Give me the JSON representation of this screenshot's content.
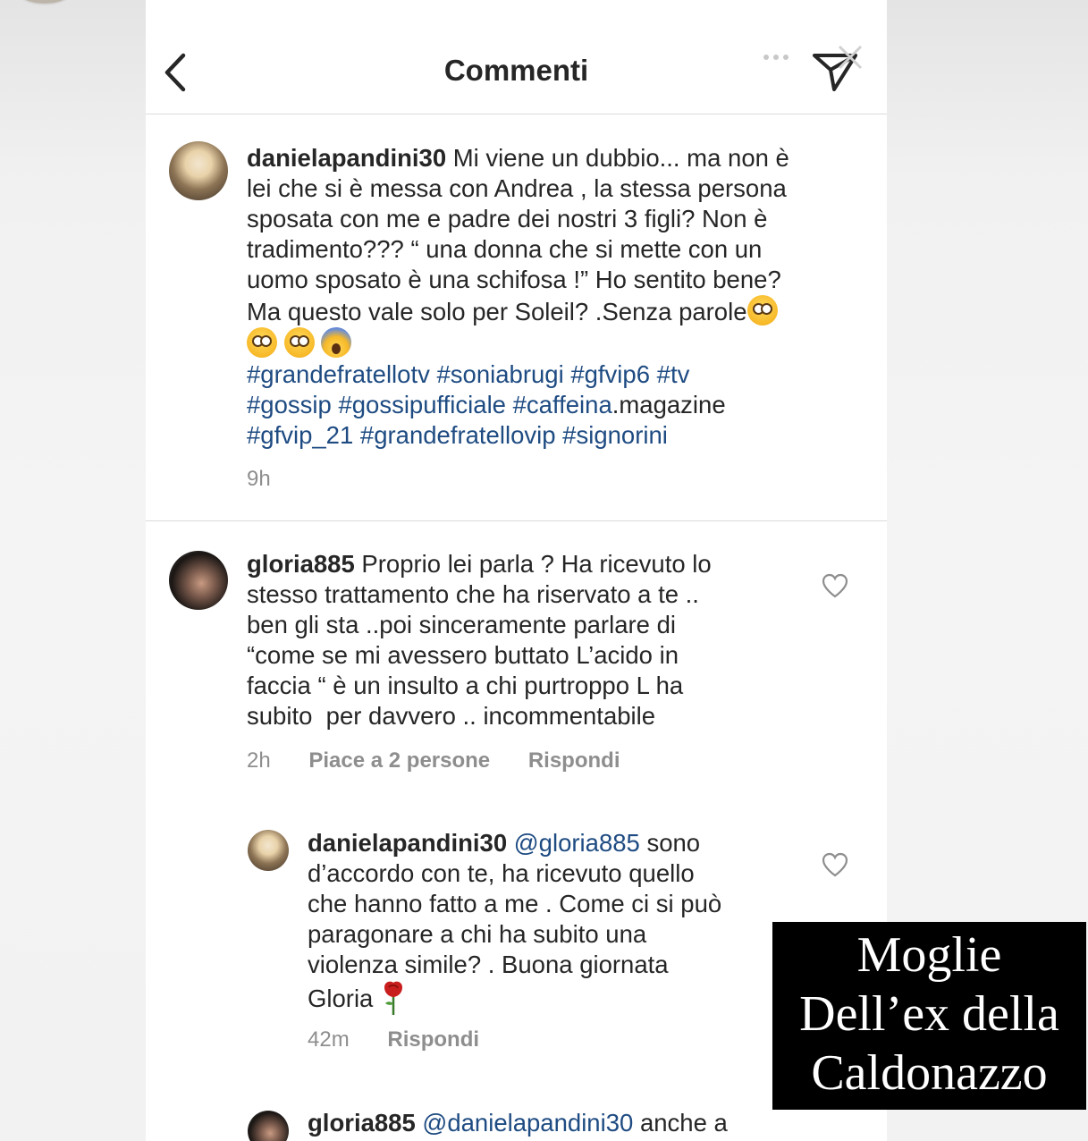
{
  "header": {
    "title": "Commenti"
  },
  "post_comment": {
    "username": "danielapandini30",
    "lines": [
      "Mi viene un dubbio... ma non è",
      "lei che si è messa con Andrea , la stessa persona",
      "sposata con me e padre dei nostri 3 figli? Non è",
      "tradimento??? “ una donna che si mette con un",
      "uomo sposato è una schifosa !” Ho sentito bene?",
      "Ma questo vale solo per Soleil? .Senza parole"
    ],
    "hashtags_line1": [
      "#grandefratellotv",
      "#soniabrugi",
      "#gfvip6",
      "#tv"
    ],
    "hashtags_line2": [
      "#gossip",
      "#gossipufficiale",
      "#caffeina"
    ],
    "hashtags_line2_suffix": ".magazine",
    "hashtags_line3": [
      "#gfvip_21",
      "#grandefratellovip",
      "#signorini"
    ],
    "time": "9h"
  },
  "comment_1": {
    "username": "gloria885",
    "lines": [
      "Proprio lei parla ? Ha ricevuto lo",
      "stesso trattamento che ha riservato a te ..",
      "ben gli sta ..poi sinceramente parlare di",
      "“come se mi avessero buttato L’acido in",
      "faccia “ è un insulto a chi purtroppo L ha",
      "subito  per davvero .. incommentabile"
    ],
    "time": "2h",
    "likes": "Piace a 2 persone",
    "reply_label": "Rispondi"
  },
  "reply_1": {
    "username": "danielapandini30",
    "mention": "@gloria885",
    "lines": [
      "sono",
      "d’accordo con te, ha ricevuto quello",
      "che hanno fatto a me . Come ci si può",
      "paragonare a chi ha subito una",
      "violenza simile? . Buona giornata",
      "Gloria"
    ],
    "time": "42m",
    "reply_label": "Rispondi"
  },
  "reply_2": {
    "username": "gloria885",
    "mention": "@danielapandini30",
    "text": "anche a"
  },
  "caption": {
    "line1": "Moglie",
    "line2": "Dell’ex della",
    "line3": "Caldonazzo"
  },
  "icons": {
    "back": "chevron-left-icon",
    "send": "paper-plane-icon",
    "like": "heart-outline-icon",
    "emoji_flushed": "flushed-face-emoji",
    "emoji_scream": "screaming-face-emoji",
    "rose": "rose-emoji"
  },
  "colors": {
    "hashtag": "#1e4b82",
    "meta_gray": "#8e8e8e",
    "text": "#262626",
    "caption_bg": "#000000"
  }
}
